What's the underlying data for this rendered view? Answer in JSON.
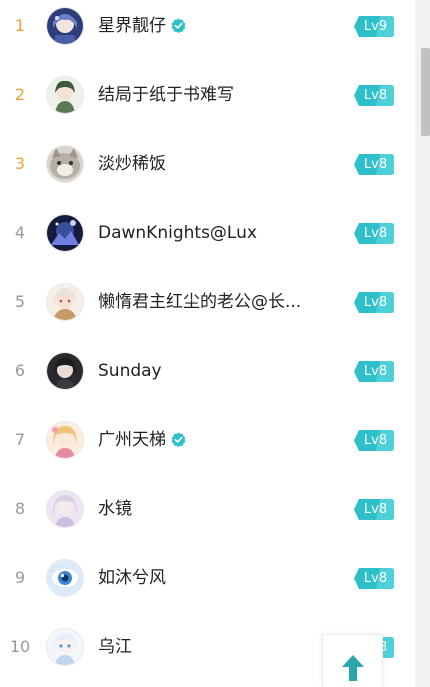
{
  "colors": {
    "rank_top": "#e8a33b",
    "rank_normal": "#999999",
    "level_badge": "#2dbfca",
    "verified_badge": "#2dbfca",
    "back_to_top_arrow": "#2aa5ae"
  },
  "leaderboard": {
    "rows": [
      {
        "rank": "1",
        "name": "星界靓仔",
        "level": "Lv9",
        "verified": true
      },
      {
        "rank": "2",
        "name": "结局于纸于书难写",
        "level": "Lv8",
        "verified": false
      },
      {
        "rank": "3",
        "name": "淡炒稀饭",
        "level": "Lv8",
        "verified": false
      },
      {
        "rank": "4",
        "name": "DawnKnights@Lux",
        "level": "Lv8",
        "verified": false
      },
      {
        "rank": "5",
        "name": "懒惰君主红尘的老公@长...",
        "level": "Lv8",
        "verified": false
      },
      {
        "rank": "6",
        "name": "Sunday",
        "level": "Lv8",
        "verified": false
      },
      {
        "rank": "7",
        "name": "广州天梯",
        "level": "Lv8",
        "verified": true
      },
      {
        "rank": "8",
        "name": "水镜",
        "level": "Lv8",
        "verified": false
      },
      {
        "rank": "9",
        "name": "如沐兮风",
        "level": "Lv8",
        "verified": false
      },
      {
        "rank": "10",
        "name": "乌江",
        "level": "Lv8",
        "verified": false
      }
    ]
  },
  "icons": {
    "verified": "verified-check-icon",
    "back_to_top": "arrow-up-icon",
    "level_badge": "level-badge-icon"
  }
}
